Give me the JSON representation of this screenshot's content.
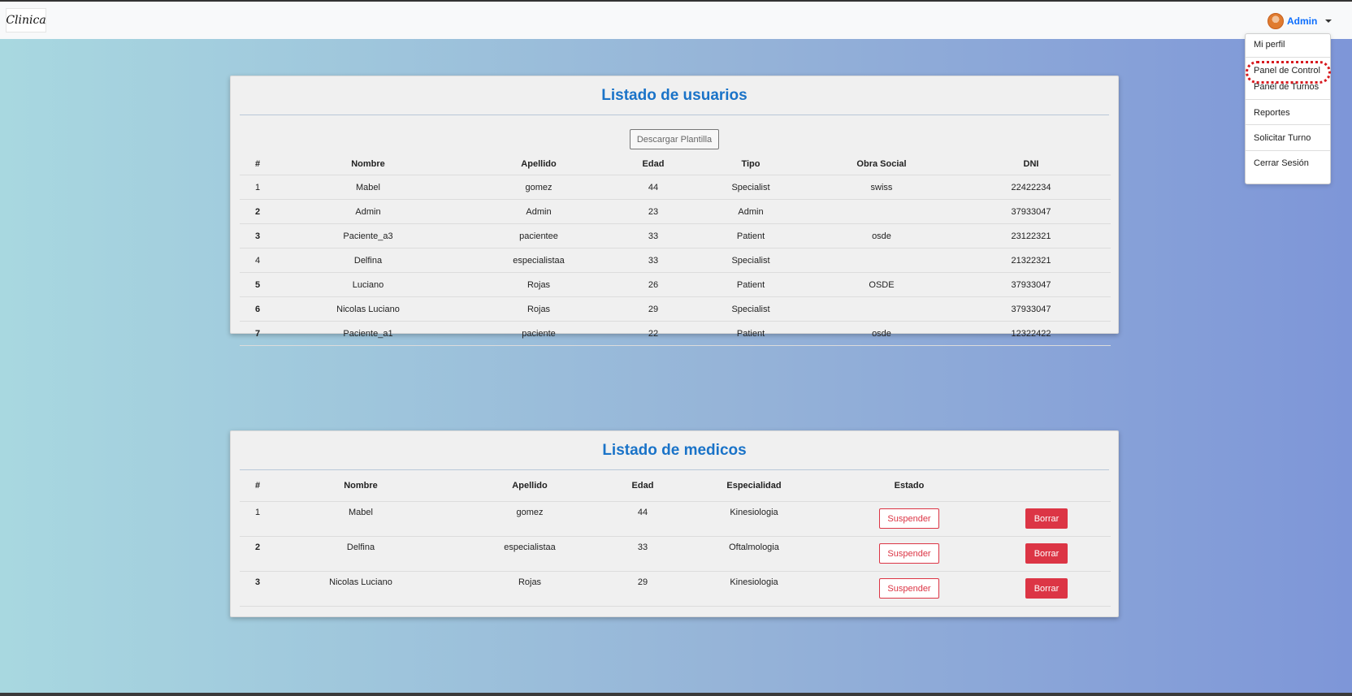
{
  "navbar": {
    "logo_text": "Clinica",
    "user": {
      "name": "Admin",
      "avatar_icon": "avatar-icon",
      "caret_icon": "caret-down-icon"
    },
    "menu": [
      {
        "label": "Mi perfil"
      },
      {
        "label": "Panel de Control",
        "highlighted": true
      },
      {
        "label": "Panel de Turnos"
      },
      {
        "label": "Reportes"
      },
      {
        "label": "Solicitar Turno"
      },
      {
        "label": "Cerrar Sesión"
      }
    ]
  },
  "users_card": {
    "title": "Listado de usuarios",
    "download_label": "Descargar Plantilla",
    "columns": [
      "#",
      "Nombre",
      "Apellido",
      "Edad",
      "Tipo",
      "Obra Social",
      "DNI"
    ],
    "rows": [
      [
        "1",
        "Mabel",
        "gomez",
        "44",
        "Specialist",
        "swiss",
        "22422234"
      ],
      [
        "2",
        "Admin",
        "Admin",
        "23",
        "Admin",
        "",
        "37933047"
      ],
      [
        "3",
        "Paciente_a3",
        "pacientee",
        "33",
        "Patient",
        "osde",
        "23122321"
      ],
      [
        "4",
        "Delfina",
        "especialistaa",
        "33",
        "Specialist",
        "",
        "21322321"
      ],
      [
        "5",
        "Luciano",
        "Rojas",
        "26",
        "Patient",
        "OSDE",
        "37933047"
      ],
      [
        "6",
        "Nicolas Luciano",
        "Rojas",
        "29",
        "Specialist",
        "",
        "37933047"
      ],
      [
        "7",
        "Paciente_a1",
        "paciente",
        "22",
        "Patient",
        "osde",
        "12322422"
      ]
    ]
  },
  "doctors_card": {
    "title": "Listado de medicos",
    "columns": [
      "#",
      "Nombre",
      "Apellido",
      "Edad",
      "Especialidad",
      "Estado",
      ""
    ],
    "suspend_label": "Suspender",
    "delete_label": "Borrar",
    "rows": [
      [
        "1",
        "Mabel",
        "gomez",
        "44",
        "Kinesiologia"
      ],
      [
        "2",
        "Delfina",
        "especialistaa",
        "33",
        "Oftalmologia"
      ],
      [
        "3",
        "Nicolas Luciano",
        "Rojas",
        "29",
        "Kinesiologia"
      ]
    ]
  },
  "colors": {
    "accent": "#1a73c8",
    "danger": "#dc3545",
    "link": "#0d6efd"
  }
}
